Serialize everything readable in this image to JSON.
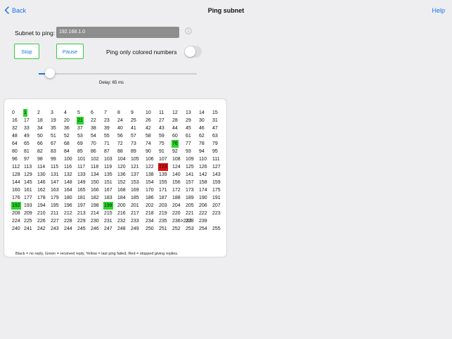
{
  "nav": {
    "back_label": "Back",
    "title": "Ping subnet",
    "help_label": "Help"
  },
  "form": {
    "subnet_label": "Subnet to ping:",
    "subnet_value": "192.168.1.0",
    "stop_label": "Stop",
    "pause_label": "Pause",
    "ping_only_label": "Ping only colored numbers",
    "ping_only_enabled": false
  },
  "slider": {
    "level": 0.07,
    "delay_label": "Delay: 65 ms"
  },
  "results": {
    "rows": [
      [
        "0",
        "1",
        "2",
        "3",
        "4",
        "5",
        "6",
        "7",
        "8",
        "9",
        "10",
        "11",
        "12",
        "13",
        "14",
        "15"
      ],
      [
        "16",
        "17",
        "18",
        "19",
        "20",
        "21",
        "22",
        "23",
        "24",
        "25",
        "26",
        "27",
        "28",
        "29",
        "30",
        "31"
      ],
      [
        "32",
        "33",
        "34",
        "35",
        "36",
        "37",
        "38",
        "39",
        "40",
        "41",
        "42",
        "43",
        "44",
        "45",
        "46",
        "47"
      ],
      [
        "48",
        "49",
        "50",
        "51",
        "52",
        "53",
        "54",
        "55",
        "56",
        "57",
        "58",
        "59",
        "60",
        "61",
        "62",
        "63"
      ],
      [
        "64",
        "65",
        "66",
        "67",
        "68",
        "69",
        "70",
        "71",
        "72",
        "73",
        "74",
        "75",
        "76",
        "77",
        "78",
        "79"
      ],
      [
        "80",
        "81",
        "82",
        "83",
        "84",
        "85",
        "86",
        "87",
        "88",
        "89",
        "90",
        "91",
        "92",
        "93",
        "94",
        "95"
      ],
      [
        "96",
        "97",
        "98",
        "99",
        "100",
        "101",
        "102",
        "103",
        "104",
        "105",
        "106",
        "107",
        "108",
        "109",
        "110",
        "111"
      ],
      [
        "112",
        "113",
        "114",
        "115",
        "116",
        "117",
        "118",
        "119",
        "120",
        "121",
        "122",
        "123",
        "124",
        "125",
        "126",
        "127"
      ],
      [
        "128",
        "129",
        "130",
        "131",
        "132",
        "133",
        "134",
        "135",
        "136",
        "137",
        "138",
        "139",
        "140",
        "141",
        "142",
        "143"
      ],
      [
        "144",
        "145",
        "146",
        "147",
        "148",
        "149",
        "150",
        "151",
        "152",
        "153",
        "154",
        "155",
        "156",
        "157",
        "158",
        "159"
      ],
      [
        "160",
        "161",
        "162",
        "163",
        "164",
        "165",
        "166",
        "167",
        "168",
        "169",
        "170",
        "171",
        "172",
        "173",
        "174",
        "175"
      ],
      [
        "176",
        "177",
        "178",
        "179",
        "180",
        "181",
        "182",
        "183",
        "184",
        "185",
        "186",
        "187",
        "188",
        "189",
        "190",
        "191"
      ],
      [
        "192",
        "193",
        "194",
        "195",
        "196",
        "197",
        "198",
        "199",
        "200",
        "201",
        "202",
        "203",
        "204",
        "205",
        "206",
        "207"
      ],
      [
        "208",
        "209",
        "210",
        "211",
        "212",
        "213",
        "214",
        "215",
        "216",
        "217",
        "218",
        "219",
        "220",
        "221",
        "222",
        "223"
      ],
      [
        "224",
        "225",
        "226",
        "227",
        "228",
        "229",
        "230",
        "231",
        "232",
        "233",
        "234",
        "235",
        "236>237",
        "238",
        "239"
      ],
      [
        "240",
        "241",
        "242",
        "243",
        "244",
        "245",
        "246",
        "247",
        "248",
        "249",
        "250",
        "251",
        "252",
        "253",
        "254",
        "255"
      ]
    ],
    "status": {
      "1": "green",
      "21": "green",
      "76": "green",
      "192": "green",
      "199": "green",
      "123": "red"
    },
    "status_colors": {
      "green": "#2bd52b",
      "red": "#e01010",
      "yellow": "#ffe100"
    },
    "legend": "Black = no reply, Green = received reply, Yellow = last ping failed, Red = stopped giving replies."
  }
}
